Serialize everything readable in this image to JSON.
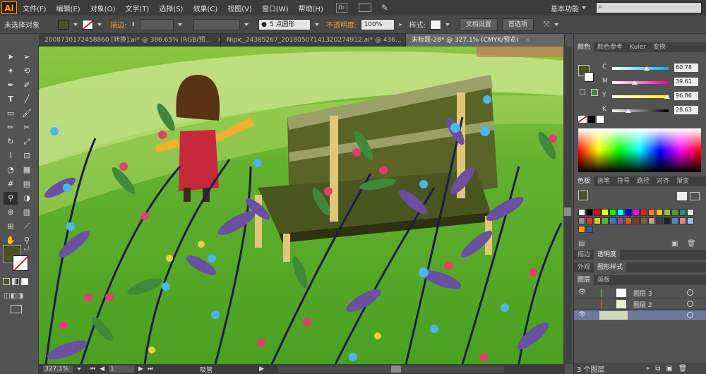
{
  "menubar": {
    "logo": "Ai",
    "items": [
      "文件(F)",
      "编辑(E)",
      "对象(O)",
      "文字(T)",
      "选择(S)",
      "效果(C)",
      "视图(V)",
      "窗口(W)",
      "帮助(H)"
    ],
    "workspace": "基本功能",
    "search_placeholder": ""
  },
  "controlbar": {
    "selection_label": "未选择对象",
    "stroke_label": "描边:",
    "brush_value": "5 点圆形",
    "opacity_label": "不透明度:",
    "opacity_value": "100%",
    "style_label": "样式:",
    "doc_setup_button": "文档设置",
    "preferences_button": "首选项",
    "fill_color": "#4b5220"
  },
  "tabs": [
    {
      "label": "20087301724588​60 [转换].ai* @ 386.65% (RGB/预..."
    },
    {
      "label": "Nipic_24385267_20180507141320274912.ai* @ 436..."
    },
    {
      "label": "未标题-28* @ 327.1% (CMYK/预览)"
    }
  ],
  "color_panel": {
    "tabs": [
      "颜色",
      "颜色参考",
      "Kuler",
      "变换"
    ],
    "channels": [
      {
        "label": "C",
        "value": "60.78",
        "pos": 0.61,
        "gradient": [
          "#ffffff",
          "#00aeef"
        ]
      },
      {
        "label": "M",
        "value": "39.61",
        "pos": 0.4,
        "gradient": [
          "#ffffff",
          "#ec008c"
        ]
      },
      {
        "label": "Y",
        "value": "96.86",
        "pos": 0.97,
        "gradient": [
          "#ffffff",
          "#fff200"
        ]
      },
      {
        "label": "K",
        "value": "28.63",
        "pos": 0.29,
        "gradient": [
          "#ffffff",
          "#000000"
        ]
      }
    ]
  },
  "swatch_panel": {
    "tabs": [
      "色板",
      "画笔",
      "符号",
      "路径",
      "对齐",
      "渐变"
    ]
  },
  "transparency_panel": {
    "tabs": [
      "描边",
      "透明度"
    ]
  },
  "appearance_panel": {
    "tabs": [
      "外观",
      "图形样式"
    ]
  },
  "layers_panel": {
    "tabs": [
      "图层",
      "画板"
    ],
    "layers": [
      {
        "name": "图层 3",
        "color": "#4fa84f"
      },
      {
        "name": "图层 2",
        "color": "#e04040"
      }
    ],
    "count_label": "3 个图层"
  },
  "statusbar": {
    "zoom": "327.1%",
    "page": "1",
    "tool_label": "吸管"
  }
}
